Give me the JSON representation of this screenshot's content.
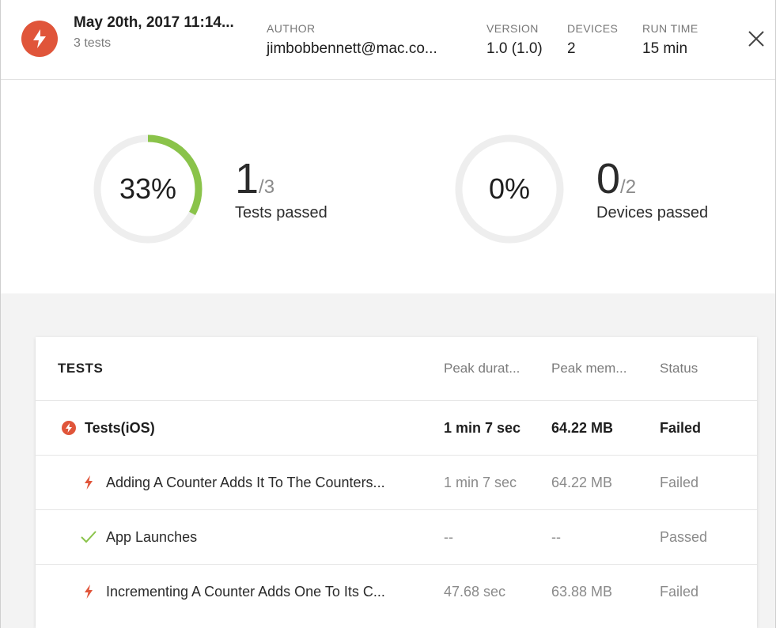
{
  "header": {
    "title": "May 20th, 2017 11:14...",
    "subtitle": "3 tests",
    "author_label": "AUTHOR",
    "author_value": "jimbobbennett@mac.co...",
    "version_label": "VERSION",
    "version_value": "1.0 (1.0)",
    "devices_label": "DEVICES",
    "devices_value": "2",
    "runtime_label": "RUN TIME",
    "runtime_value": "15 min",
    "close_icon": "close-icon"
  },
  "summary": {
    "tests": {
      "percent_label": "33%",
      "fraction": 0.33,
      "passed": "1",
      "total": "/3",
      "caption": "Tests passed"
    },
    "devices": {
      "percent_label": "0%",
      "fraction": 0,
      "passed": "0",
      "total": "/2",
      "caption": "Devices passed"
    }
  },
  "tests_table": {
    "headers": {
      "name": "TESTS",
      "duration": "Peak durat...",
      "memory": "Peak mem...",
      "status": "Status"
    },
    "group": {
      "name": "Tests(iOS)",
      "duration": "1 min 7 sec",
      "memory": "64.22 MB",
      "status": "Failed",
      "icon": "failed-circle-icon"
    },
    "rows": [
      {
        "name": "Adding A Counter Adds It To The Counters...",
        "duration": "1 min 7 sec",
        "memory": "64.22 MB",
        "status": "Failed",
        "icon": "lightning-icon"
      },
      {
        "name": "App Launches",
        "duration": "--",
        "memory": "--",
        "status": "Passed",
        "icon": "checkmark-icon"
      },
      {
        "name": "Incrementing A Counter Adds One To Its C...",
        "duration": "47.68 sec",
        "memory": "63.88 MB",
        "status": "Failed",
        "icon": "lightning-icon"
      }
    ]
  },
  "colors": {
    "fail_red": "#e0553a",
    "pass_green": "#8ac34a",
    "ring_track": "#eeeeee"
  }
}
